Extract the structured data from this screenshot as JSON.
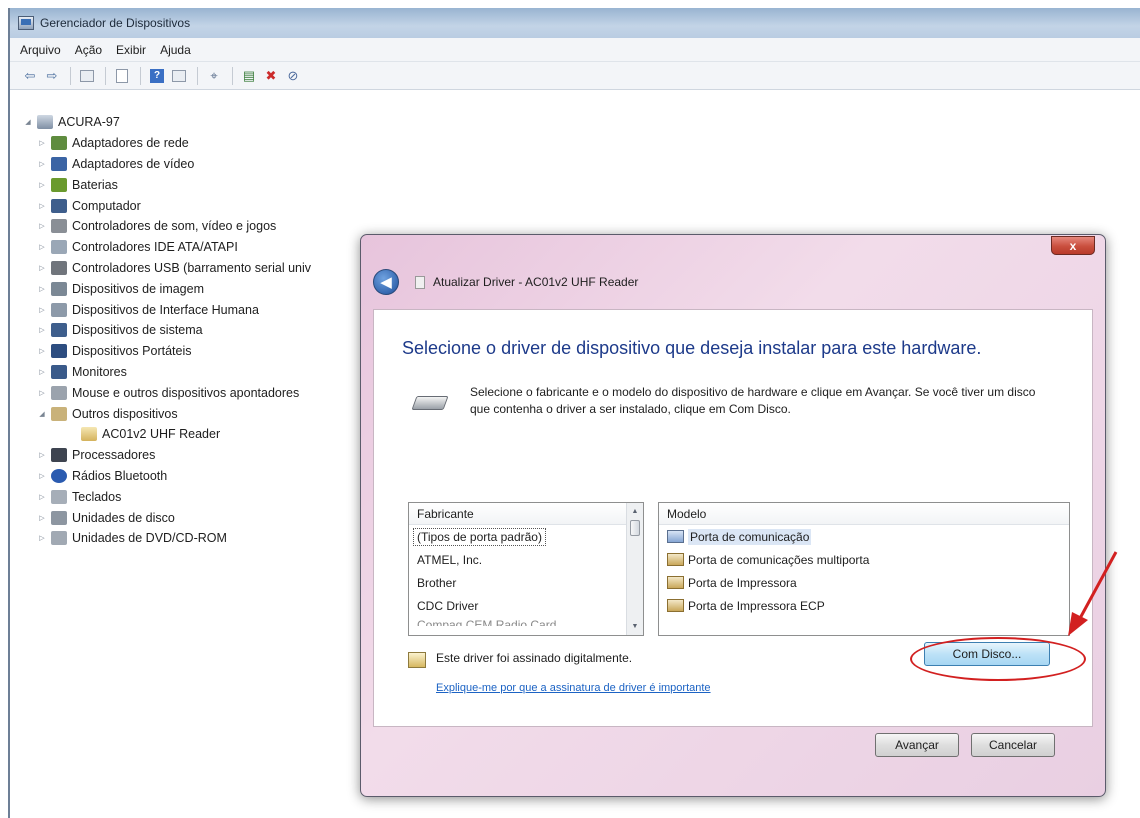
{
  "window": {
    "title": "Gerenciador de Dispositivos"
  },
  "menu": [
    "Arquivo",
    "Ação",
    "Exibir",
    "Ajuda"
  ],
  "tree": {
    "root": "ACURA-97",
    "items": [
      "Adaptadores de rede",
      "Adaptadores de vídeo",
      "Baterias",
      "Computador",
      "Controladores de som, vídeo e jogos",
      "Controladores IDE ATA/ATAPI",
      "Controladores USB (barramento serial univ",
      "Dispositivos de imagem",
      "Dispositivos de Interface Humana",
      "Dispositivos de sistema",
      "Dispositivos Portáteis",
      "Monitores",
      "Mouse e outros dispositivos apontadores",
      "Outros dispositivos",
      "Processadores",
      "Rádios Bluetooth",
      "Teclados",
      "Unidades de disco",
      "Unidades de DVD/CD-ROM"
    ],
    "child": "AC01v2 UHF Reader"
  },
  "dialog": {
    "close_label": "x",
    "title": "Atualizar Driver - AC01v2 UHF Reader",
    "heading": "Selecione o driver de dispositivo que deseja instalar para este hardware.",
    "description": "Selecione o fabricante e o modelo do dispositivo de hardware e clique em Avançar. Se você tiver um disco que contenha o driver a ser instalado, clique em Com Disco.",
    "manufacturer_header": "Fabricante",
    "manufacturers": [
      "(Tipos de porta padrão)",
      "ATMEL, Inc.",
      "Brother",
      "CDC Driver",
      "Compaq CEM Radio Card"
    ],
    "model_header": "Modelo",
    "models": [
      "Porta de comunicação",
      "Porta de comunicações multiporta",
      "Porta de Impressora",
      "Porta de Impressora ECP"
    ],
    "signed_text": "Este driver foi assinado digitalmente.",
    "help_link": "Explique-me por que a assinatura de driver é importante",
    "have_disk_button": "Com Disco...",
    "next_button": "Avançar",
    "cancel_button": "Cancelar"
  },
  "colors": {
    "heading": "#1d3a8a",
    "link": "#1c63c4",
    "annotation": "#d22020",
    "dialog_frame": "#e7c4dc"
  }
}
